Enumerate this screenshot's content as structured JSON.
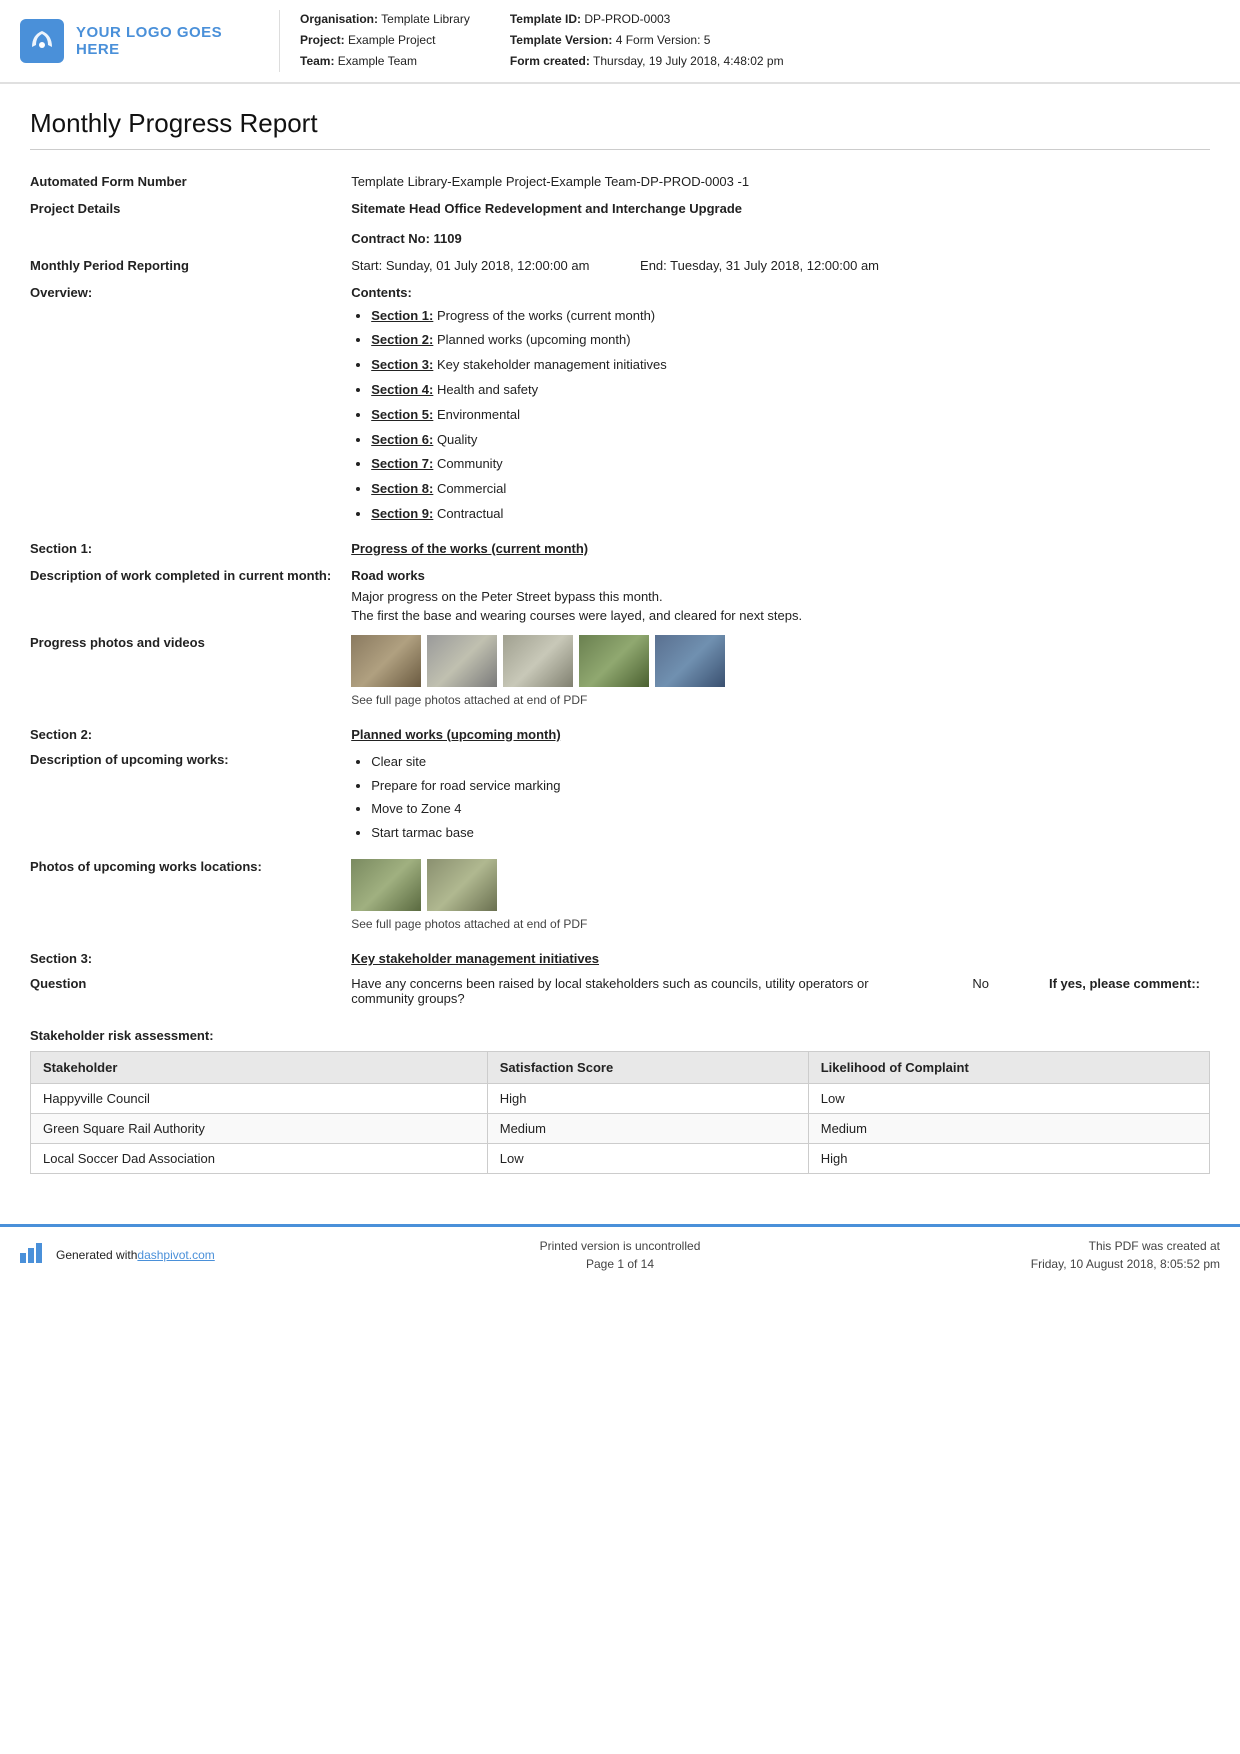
{
  "header": {
    "logo_text": "YOUR LOGO GOES HERE",
    "org_label": "Organisation:",
    "org_value": "Template Library",
    "project_label": "Project:",
    "project_value": "Example Project",
    "team_label": "Team:",
    "team_value": "Example Team",
    "template_id_label": "Template ID:",
    "template_id_value": "DP-PROD-0003",
    "template_version_label": "Template Version:",
    "template_version_value": "4",
    "form_version_label": "Form Version:",
    "form_version_value": "5",
    "form_created_label": "Form created:",
    "form_created_value": "Thursday, 19 July 2018, 4:48:02 pm"
  },
  "page_title": "Monthly Progress Report",
  "form_number_label": "Automated Form Number",
  "form_number_value": "Template Library-Example Project-Example Team-DP-PROD-0003   -1",
  "project_details_label": "Project Details",
  "project_details_value": "Sitemate Head Office Redevelopment and Interchange Upgrade",
  "contract_label": "Contract No:",
  "contract_value": "1109",
  "monthly_period_label": "Monthly Period Reporting",
  "period_start": "Start: Sunday, 01 July 2018, 12:00:00 am",
  "period_end": "End: Tuesday, 31 July 2018, 12:00:00 am",
  "overview_label": "Overview:",
  "overview_contents_label": "Contents:",
  "contents_items": [
    {
      "link": "Section 1:",
      "text": " Progress of the works (current month)"
    },
    {
      "link": "Section 2:",
      "text": " Planned works (upcoming month)"
    },
    {
      "link": "Section 3:",
      "text": " Key stakeholder management initiatives"
    },
    {
      "link": "Section 4:",
      "text": " Health and safety"
    },
    {
      "link": "Section 5:",
      "text": " Environmental"
    },
    {
      "link": "Section 6:",
      "text": " Quality"
    },
    {
      "link": "Section 7:",
      "text": " Community"
    },
    {
      "link": "Section 8:",
      "text": " Commercial"
    },
    {
      "link": "Section 9:",
      "text": " Contractual"
    }
  ],
  "section1_label": "Section 1:",
  "section1_title": "Progress of the works (current month)",
  "desc_work_label": "Description of work completed in current month:",
  "desc_work_title": "Road works",
  "desc_work_line1": "Major progress on the Peter Street bypass this month.",
  "desc_work_line2": "The first the base and wearing courses were layed, and cleared for next steps.",
  "progress_photos_label": "Progress photos and videos",
  "photo_caption": "See full page photos attached at end of PDF",
  "section2_label": "Section 2:",
  "section2_title": "Planned works (upcoming month)",
  "upcoming_works_label": "Description of upcoming works:",
  "upcoming_works_items": [
    "Clear site",
    "Prepare for road service marking",
    "Move to Zone 4",
    "Start tarmac base"
  ],
  "upcoming_photos_label": "Photos of upcoming works locations:",
  "upcoming_photo_caption": "See full page photos attached at end of PDF",
  "section3_label": "Section 3:",
  "section3_title": "Key stakeholder management initiatives",
  "question_label": "Question",
  "question_text": "Have any concerns been raised by local stakeholders such as councils, utility operators or community groups?",
  "question_answer_no": "No",
  "question_if_yes": "If yes, please comment::",
  "stakeholder_risk_label": "Stakeholder risk assessment:",
  "stakeholder_table_headers": [
    "Stakeholder",
    "Satisfaction Score",
    "Likelihood of Complaint"
  ],
  "stakeholder_rows": [
    [
      "Happyville Council",
      "High",
      "Low"
    ],
    [
      "Green Square Rail Authority",
      "Medium",
      "Medium"
    ],
    [
      "Local Soccer Dad Association",
      "Low",
      "High"
    ]
  ],
  "footer_generated": "Generated with ",
  "footer_link_text": "dashpivot.com",
  "footer_uncontrolled": "Printed version is uncontrolled",
  "footer_page": "Page 1 of 14",
  "footer_pdf_created": "This PDF was created at",
  "footer_pdf_date": "Friday, 10 August 2018, 8:05:52 pm"
}
